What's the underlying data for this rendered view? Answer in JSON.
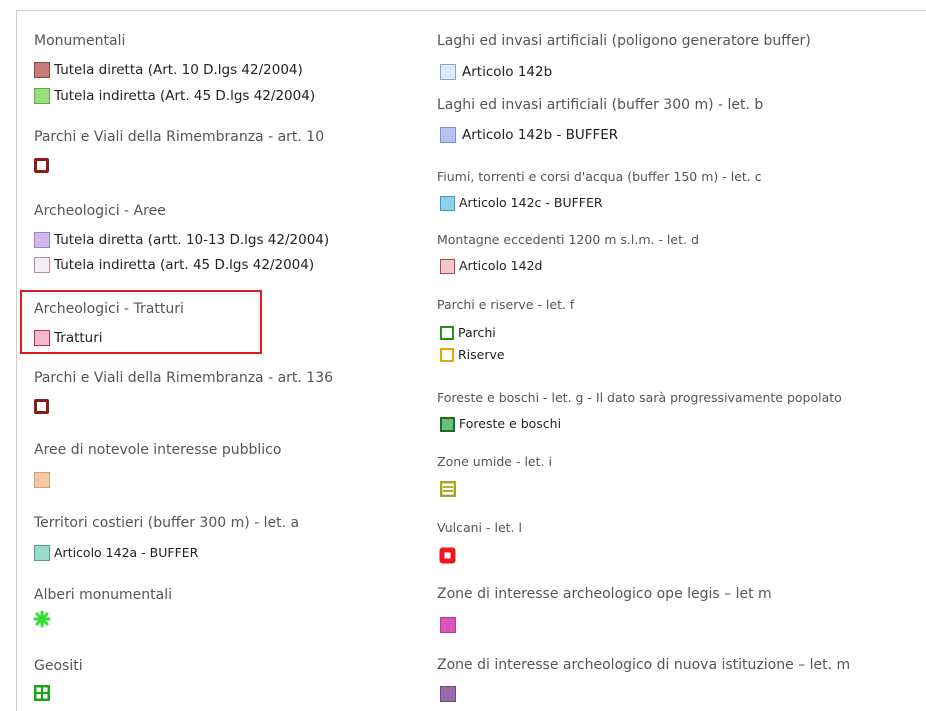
{
  "legend": {
    "left": {
      "monumentali": {
        "title": "Monumentali",
        "items": [
          "Tutela diretta (Art. 10 D.lgs 42/2004)",
          "Tutela indiretta (Art. 45 D.lgs 42/2004)"
        ]
      },
      "parchi_viali_10": {
        "title": "Parchi e Viali della Rimembranza - art. 10"
      },
      "archeologici_aree": {
        "title": "Archeologici - Aree",
        "items": [
          "Tutela diretta (artt. 10-13 D.lgs 42/2004)",
          "Tutela indiretta (art. 45 D.lgs 42/2004)"
        ]
      },
      "archeologici_tratturi": {
        "title": "Archeologici - Tratturi",
        "items": [
          "Tratturi"
        ]
      },
      "parchi_viali_136": {
        "title": "Parchi e Viali della Rimembranza - art. 136"
      },
      "aree_notevole": {
        "title": "Aree di notevole interesse pubblico"
      },
      "territori_costieri": {
        "title": "Territori costieri (buffer 300 m) - let. a",
        "items": [
          "Articolo 142a - BUFFER"
        ]
      },
      "alberi": {
        "title": "Alberi monumentali"
      },
      "geositi": {
        "title": "Geositi"
      }
    },
    "right": {
      "laghi": {
        "title": "Laghi ed invasi artificiali (poligono generatore buffer)",
        "items": [
          "Articolo 142b"
        ]
      },
      "laghi_buffer": {
        "title": "Laghi ed invasi artificiali (buffer 300 m) - let. b",
        "items": [
          "Articolo 142b - BUFFER"
        ]
      },
      "fiumi": {
        "title": "Fiumi, torrenti e corsi d'acqua (buffer 150 m) - let. c",
        "items": [
          "Articolo 142c - BUFFER"
        ]
      },
      "montagne": {
        "title": "Montagne eccedenti 1200 m s.l.m. - let. d",
        "items": [
          "Articolo 142d"
        ]
      },
      "parchi_riserve": {
        "title": "Parchi e riserve - let. f",
        "items": [
          "Parchi",
          "Riserve"
        ]
      },
      "foreste": {
        "title": "Foreste e boschi - let. g - Il dato sarà progressivamente popolato",
        "items": [
          "Foreste e boschi"
        ]
      },
      "zone_umide": {
        "title": "Zone umide - let. i"
      },
      "vulcani": {
        "title": "Vulcani - let. l"
      },
      "zone_arch_ope": {
        "title": "Zone di interesse archeologico ope legis – let m"
      },
      "zone_arch_nuova": {
        "title": "Zone di interesse archeologico di nuova istituzione – let. m"
      }
    }
  },
  "colors": {
    "highlight": "#e01b1b",
    "monumentali_diretta": "#c87a7a",
    "monumentali_indiretta": "#9bdf7c",
    "parchi_viali": "#8b1a1a",
    "arch_diretta": "#d4b8ec",
    "arch_indiretta": "#f6eef3",
    "tratturi": "#f4b7cc",
    "aree_notevole": "#f5c9a0",
    "costieri": "#9edbcf",
    "alberi": "#33dd33",
    "geositi": "#1aa51a",
    "laghi_142b": "#dcecff",
    "laghi_buffer": "#b4c4f2",
    "fiumi": "#8fd0ea",
    "montagne": "#f2c9c9",
    "parchi": "#2e8b2e",
    "riserve": "#e0a800",
    "foreste": "#6bbd7b",
    "umide": "#a3a820",
    "vulcani": "#e8191f",
    "arch_ope": "#dd55bb",
    "arch_nuova": "#9a6aa6"
  },
  "icons": {
    "alberi": "asterisk-icon",
    "geositi": "grid-square-icon",
    "zone_umide": "striped-square-icon",
    "vulcani": "filled-dot-square-icon"
  }
}
